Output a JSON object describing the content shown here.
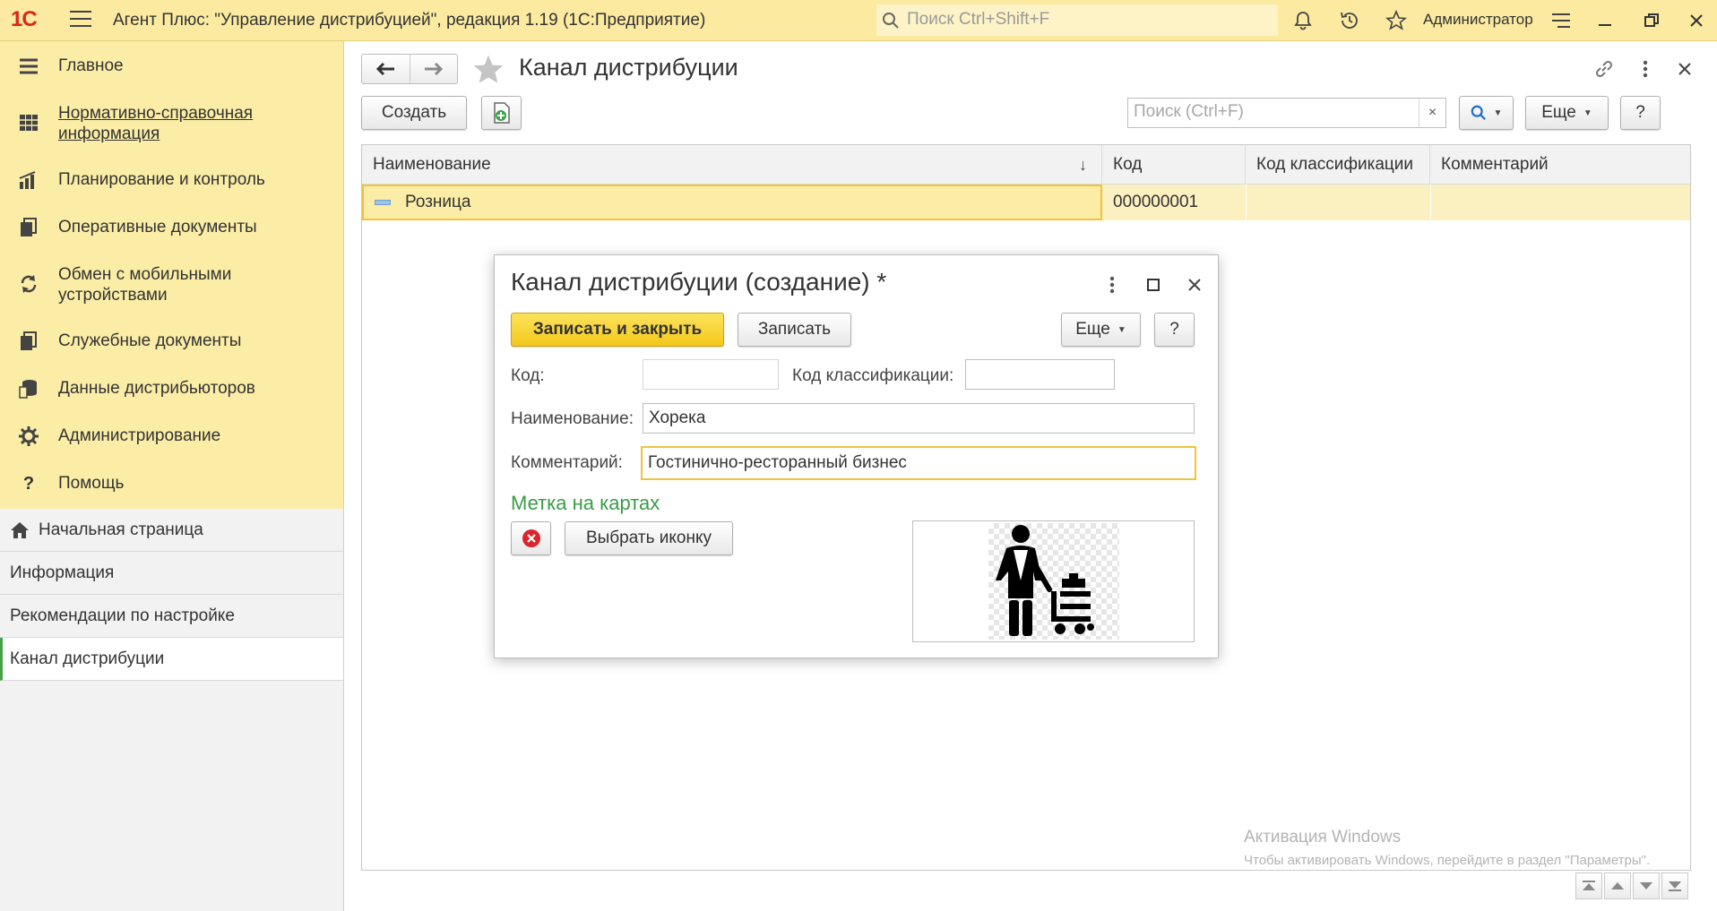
{
  "app": {
    "logo": "1С",
    "window_title": "Агент Плюс: \"Управление дистрибуцией\", редакция 1.19  (1С:Предприятие)",
    "search_placeholder": "Поиск Ctrl+Shift+F",
    "user": "Администратор"
  },
  "sidebar": {
    "sections": [
      {
        "label": "Главное",
        "icon": "menu-lines-icon"
      },
      {
        "label": "Нормативно-справочная информация",
        "icon": "grid-icon"
      },
      {
        "label": "Планирование и контроль",
        "icon": "bar-chart-icon"
      },
      {
        "label": "Оперативные документы",
        "icon": "documents-icon"
      },
      {
        "label": "Обмен с мобильными устройствами",
        "icon": "sync-icon"
      },
      {
        "label": "Служебные документы",
        "icon": "documents-icon"
      },
      {
        "label": "Данные дистрибьюторов",
        "icon": "database-icon"
      },
      {
        "label": "Администрирование",
        "icon": "gear-icon"
      },
      {
        "label": "Помощь",
        "icon": "help-icon"
      }
    ],
    "open_items": [
      {
        "label": "Начальная страница",
        "icon": "home-icon"
      },
      {
        "label": "Информация"
      },
      {
        "label": "Рекомендации по настройке"
      },
      {
        "label": "Канал дистрибуции"
      }
    ]
  },
  "list_form": {
    "title": "Канал дистрибуции",
    "create_label": "Создать",
    "search_placeholder": "Поиск (Ctrl+F)",
    "clear_symbol": "×",
    "more_label": "Еще",
    "help_label": "?",
    "sort_indicator": "↓",
    "columns": [
      "Наименование",
      "Код",
      "Код классификации",
      "Комментарий"
    ],
    "rows": [
      {
        "name": "Розница",
        "code": "000000001",
        "class_code": "",
        "comment": ""
      }
    ]
  },
  "dialog": {
    "title": "Канал дистрибуции (создание) *",
    "save_close_label": "Записать и закрыть",
    "save_label": "Записать",
    "more_label": "Еще",
    "help_label": "?",
    "code_label": "Код:",
    "code_value": "",
    "class_code_label": "Код классификации:",
    "class_code_value": "",
    "name_label": "Наименование:",
    "name_value": "Хорека",
    "comment_label": "Комментарий:",
    "comment_value": "Гостинично-ресторанный бизнес",
    "map_section_title": "Метка на картах",
    "choose_icon_label": "Выбрать иконку"
  },
  "watermark": {
    "line1": "Активация Windows",
    "line2": "Чтобы активировать Windows, перейдите в раздел \"Параметры\"."
  },
  "colors": {
    "accent_yellow": "#fbeda6",
    "primary_button": "#f4c81a",
    "section_green": "#3a9c47",
    "logo_red": "#d9281b"
  }
}
